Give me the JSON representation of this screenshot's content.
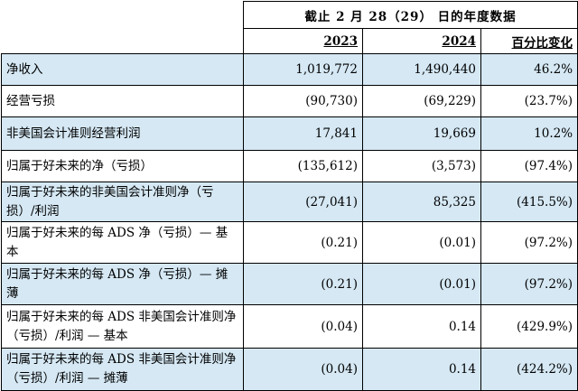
{
  "header": {
    "period": "截止 2 月 28（29） 日的年度数据",
    "columns": [
      "2023",
      "2024",
      "百分比变化"
    ]
  },
  "rows": [
    {
      "label": "净收入",
      "values": [
        "1,019,772",
        "1,490,440",
        "46.2%"
      ]
    },
    {
      "label": "经营亏损",
      "values": [
        "(90,730)",
        "(69,229)",
        "(23.7%)"
      ]
    },
    {
      "label": "非美国会计准则经营利润",
      "values": [
        "17,841",
        "19,669",
        "10.2%"
      ]
    },
    {
      "label": "归属于好未来的净（亏损）",
      "values": [
        "(135,612)",
        "(3,573)",
        "(97.4%)"
      ]
    },
    {
      "label": "归属于好未来的非美国会计准则净（亏损）/利润",
      "values": [
        "(27,041)",
        "85,325",
        "(415.5%)"
      ]
    },
    {
      "label": "归属于好未来的每 ADS 净（亏损）— 基本",
      "values": [
        "(0.21)",
        "(0.01)",
        "(97.2%)"
      ]
    },
    {
      "label": "归属于好未来的每 ADS 净（亏损）— 摊薄",
      "values": [
        "(0.21)",
        "(0.01)",
        "(97.2%)"
      ]
    },
    {
      "label": "归属于好未来的每 ADS 非美国会计准则净（亏损）/利润 — 基本",
      "values": [
        "(0.04)",
        "0.14",
        "(429.9%)"
      ]
    },
    {
      "label": "归属于好未来的每 ADS 非美国会计准则净（亏损）/利润 — 摊薄",
      "values": [
        "(0.04)",
        "0.14",
        "(424.2%)"
      ]
    }
  ]
}
